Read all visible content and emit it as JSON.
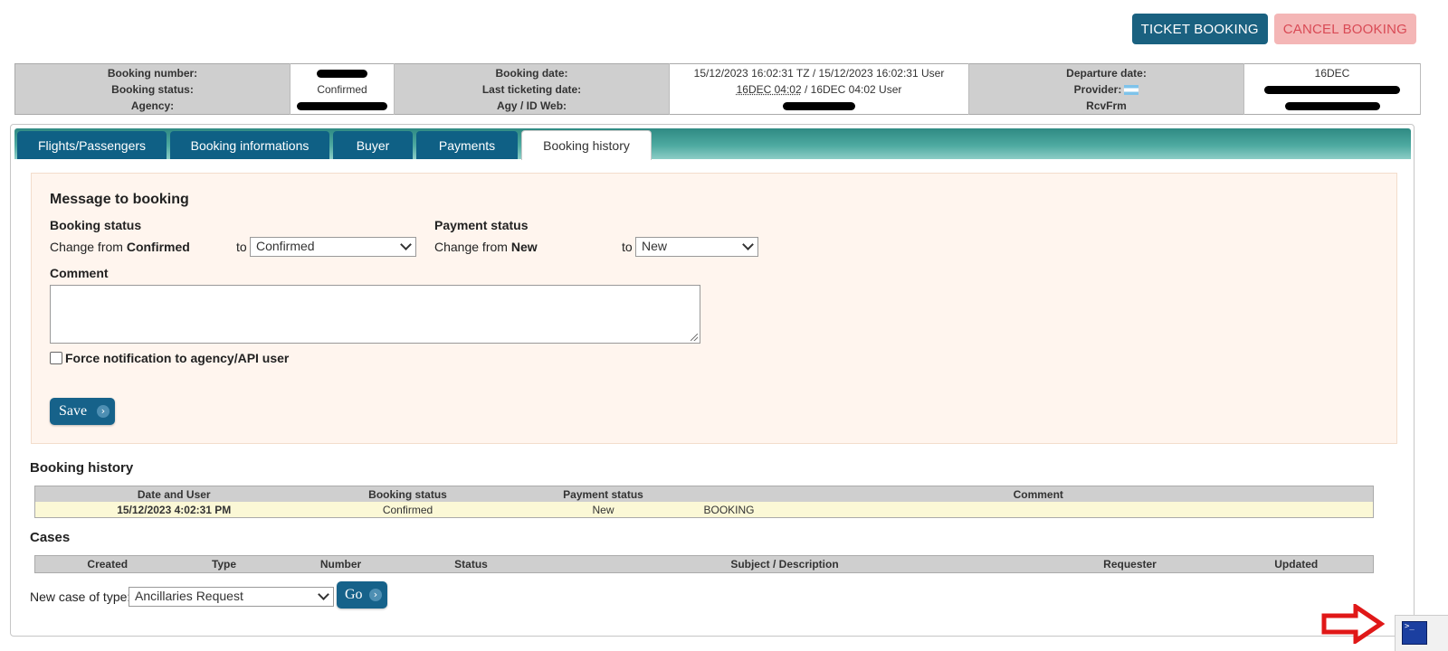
{
  "header": {
    "ticket_booking": "TICKET BOOKING",
    "cancel_booking": "CANCEL BOOKING"
  },
  "summary": {
    "booking_number_label": "Booking number:",
    "booking_status_label": "Booking status:",
    "booking_status_value": "Confirmed",
    "agency_label": "Agency:",
    "booking_date_label": "Booking date:",
    "booking_date_value": "15/12/2023 16:02:31 TZ / 15/12/2023 16:02:31 User",
    "last_ticketing_label": "Last ticketing date:",
    "last_ticketing_tz": "16DEC 04:02",
    "last_ticketing_user": " / 16DEC 04:02 User",
    "agy_label": "Agy / ID Web:",
    "departure_label": "Departure date:",
    "departure_value": "16DEC",
    "provider_label": "Provider:",
    "rcvfrm_label": "RcvFrm"
  },
  "tabs": [
    "Flights/Passengers",
    "Booking informations",
    "Buyer",
    "Payments",
    "Booking history"
  ],
  "message": {
    "title": "Message to booking",
    "booking_status_heading": "Booking status",
    "change_from": "Change from ",
    "booking_from_value": "Confirmed",
    "to": "to",
    "booking_select_value": "Confirmed",
    "payment_status_heading": "Payment status",
    "payment_from_value": "New",
    "payment_select_value": "New",
    "comment_label": "Comment",
    "force_label": "Force notification to agency/API user",
    "save": "Save"
  },
  "history": {
    "title": "Booking history",
    "columns": [
      "Date and User",
      "Booking status",
      "Payment status",
      "Comment"
    ],
    "rows": [
      {
        "date": "15/12/2023 4:02:31 PM",
        "booking_status": "Confirmed",
        "payment_status": "New",
        "comment": "BOOKING"
      }
    ]
  },
  "cases": {
    "title": "Cases",
    "columns": [
      "Created",
      "Type",
      "Number",
      "Status",
      "Subject / Description",
      "Requester",
      "Updated"
    ],
    "new_case_label": "New case of type:",
    "new_case_value": "Ancillaries Request",
    "go": "Go"
  },
  "icons": {
    "arrow": "chevron-right-circle-icon",
    "flag": "argentina-flag-icon",
    "terminal": "terminal-icon",
    "red_arrow": "red-arrow-right-icon"
  },
  "colors": {
    "primary": "#16628a",
    "teal": "#3a958d",
    "cancel_bg": "#f4b6b6",
    "cancel_text": "#d94a55",
    "message_bg": "#fff5ee",
    "history_row": "#fbf8d6"
  }
}
